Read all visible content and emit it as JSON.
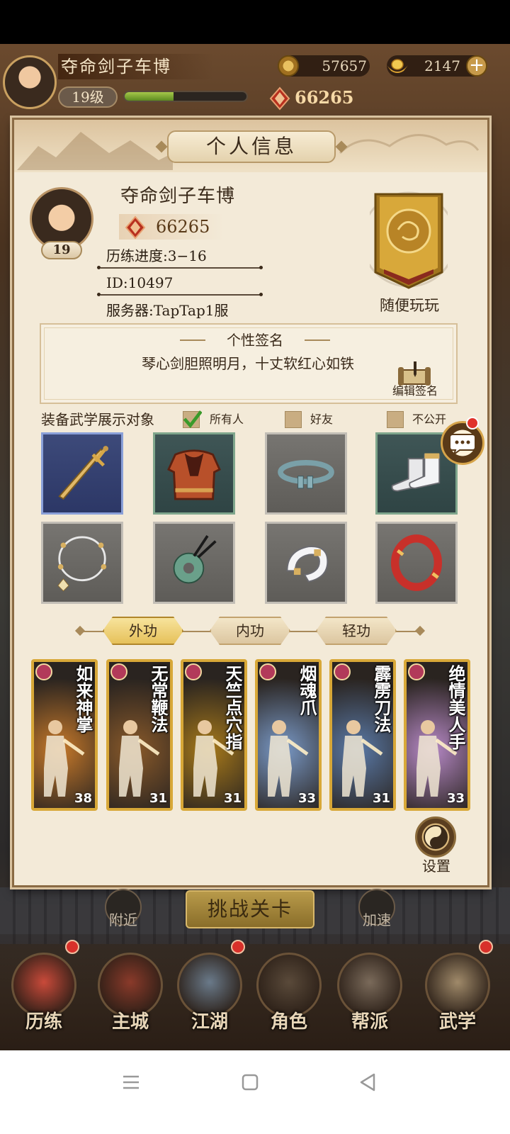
{
  "header": {
    "player_name": "夺命剑子车博",
    "level": "19级",
    "exp_fraction": 0.4,
    "power": "66265",
    "coins": "57657",
    "gold": "2147",
    "plus": "+"
  },
  "panel": {
    "title": "个人信息",
    "profile": {
      "name": "夺命剑子车博",
      "level": "19",
      "power": "66265",
      "progress": "历练进度:3−16",
      "id": "ID:10497",
      "server": "服务器:TapTap1服",
      "badge_label": "随便玩玩"
    },
    "signature": {
      "title": "个性签名",
      "text": "琴心剑胆照明月，十丈软红心如铁",
      "edit_label": "编辑签名"
    },
    "display_target": {
      "label": "装备武学展示对象",
      "options": [
        {
          "label": "所有人",
          "checked": true
        },
        {
          "label": "好友",
          "checked": false
        },
        {
          "label": "不公开",
          "checked": false
        }
      ]
    },
    "equipment": [
      {
        "name": "sword",
        "rarity": "blue"
      },
      {
        "name": "armor",
        "rarity": "green"
      },
      {
        "name": "belt",
        "rarity": "gray"
      },
      {
        "name": "boots",
        "rarity": "green"
      },
      {
        "name": "necklace",
        "rarity": "gray"
      },
      {
        "name": "jade-pendant",
        "rarity": "gray"
      },
      {
        "name": "bracelet",
        "rarity": "gray"
      },
      {
        "name": "ring",
        "rarity": "gray"
      }
    ],
    "tabs": [
      {
        "label": "外功",
        "active": true
      },
      {
        "label": "内功",
        "active": false
      },
      {
        "label": "轻功",
        "active": false
      }
    ],
    "skills": [
      {
        "name": "如来神掌",
        "level": "38",
        "color": "#c87a2a"
      },
      {
        "name": "无常鞭法",
        "level": "31",
        "color": "#8a5a2a"
      },
      {
        "name": "天竺点穴指",
        "level": "31",
        "color": "#a87a1a"
      },
      {
        "name": "烟魂爪",
        "level": "33",
        "color": "#7a9ac8"
      },
      {
        "name": "霹雳刀法",
        "level": "31",
        "color": "#5a7aa8"
      },
      {
        "name": "绝情美人手",
        "level": "33",
        "color": "#b88ac8"
      }
    ],
    "settings_label": "设置"
  },
  "below": {
    "nearby": "附近",
    "challenge": "挑战关卡",
    "speed": "加速"
  },
  "bottom_nav": [
    {
      "label": "历练",
      "dot": true,
      "color": "#c94a3a"
    },
    {
      "label": "主城",
      "dot": false,
      "color": "#8a3a2a"
    },
    {
      "label": "江湖",
      "dot": true,
      "color": "#6a7a8a"
    },
    {
      "label": "角色",
      "dot": false,
      "color": "#5a4a3a"
    },
    {
      "label": "帮派",
      "dot": false,
      "color": "#7a6a5a"
    },
    {
      "label": "武学",
      "dot": true,
      "color": "#a08a6a"
    }
  ]
}
